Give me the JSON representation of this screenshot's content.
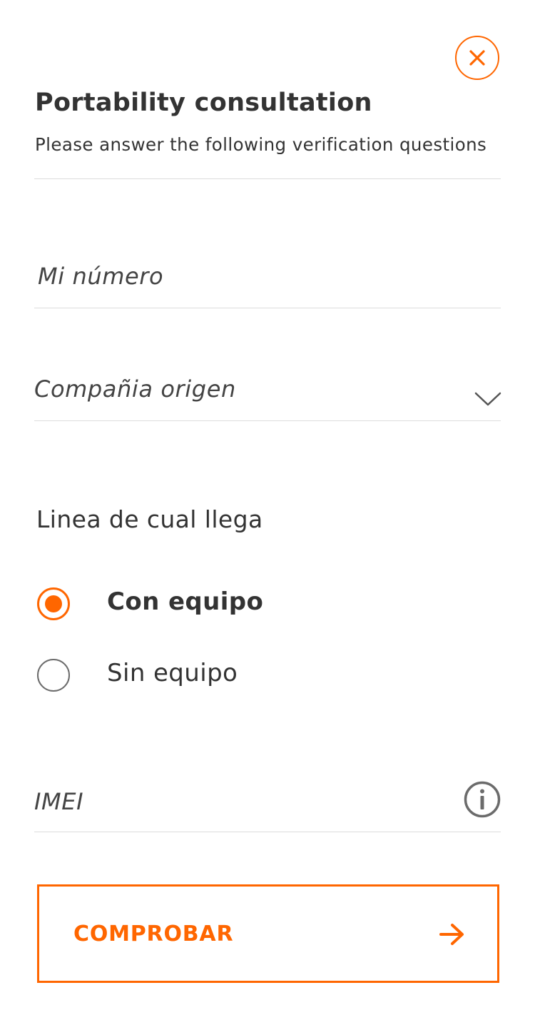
{
  "header": {
    "title": "Portability consultation",
    "subtitle": "Please answer the following verification questions",
    "close_icon": "close-icon"
  },
  "form": {
    "phone_field": {
      "placeholder": "Mi número",
      "value": ""
    },
    "origin_company_field": {
      "placeholder": "Compañia origen",
      "selected": "",
      "icon": "chevron-down-icon"
    },
    "line_type": {
      "label": "Linea de cual llega",
      "options": [
        {
          "label": "Con equipo",
          "selected": true
        },
        {
          "label": "Sin equipo",
          "selected": false
        }
      ]
    },
    "imei_field": {
      "placeholder": "IMEI",
      "value": "",
      "icon": "info-icon"
    },
    "submit": {
      "label": "COMPROBAR",
      "icon": "arrow-right-icon"
    }
  },
  "colors": {
    "accent": "#ff6600",
    "text": "#333333",
    "divider": "#dcdcdc",
    "radio_unchecked": "#6b6b6b"
  }
}
